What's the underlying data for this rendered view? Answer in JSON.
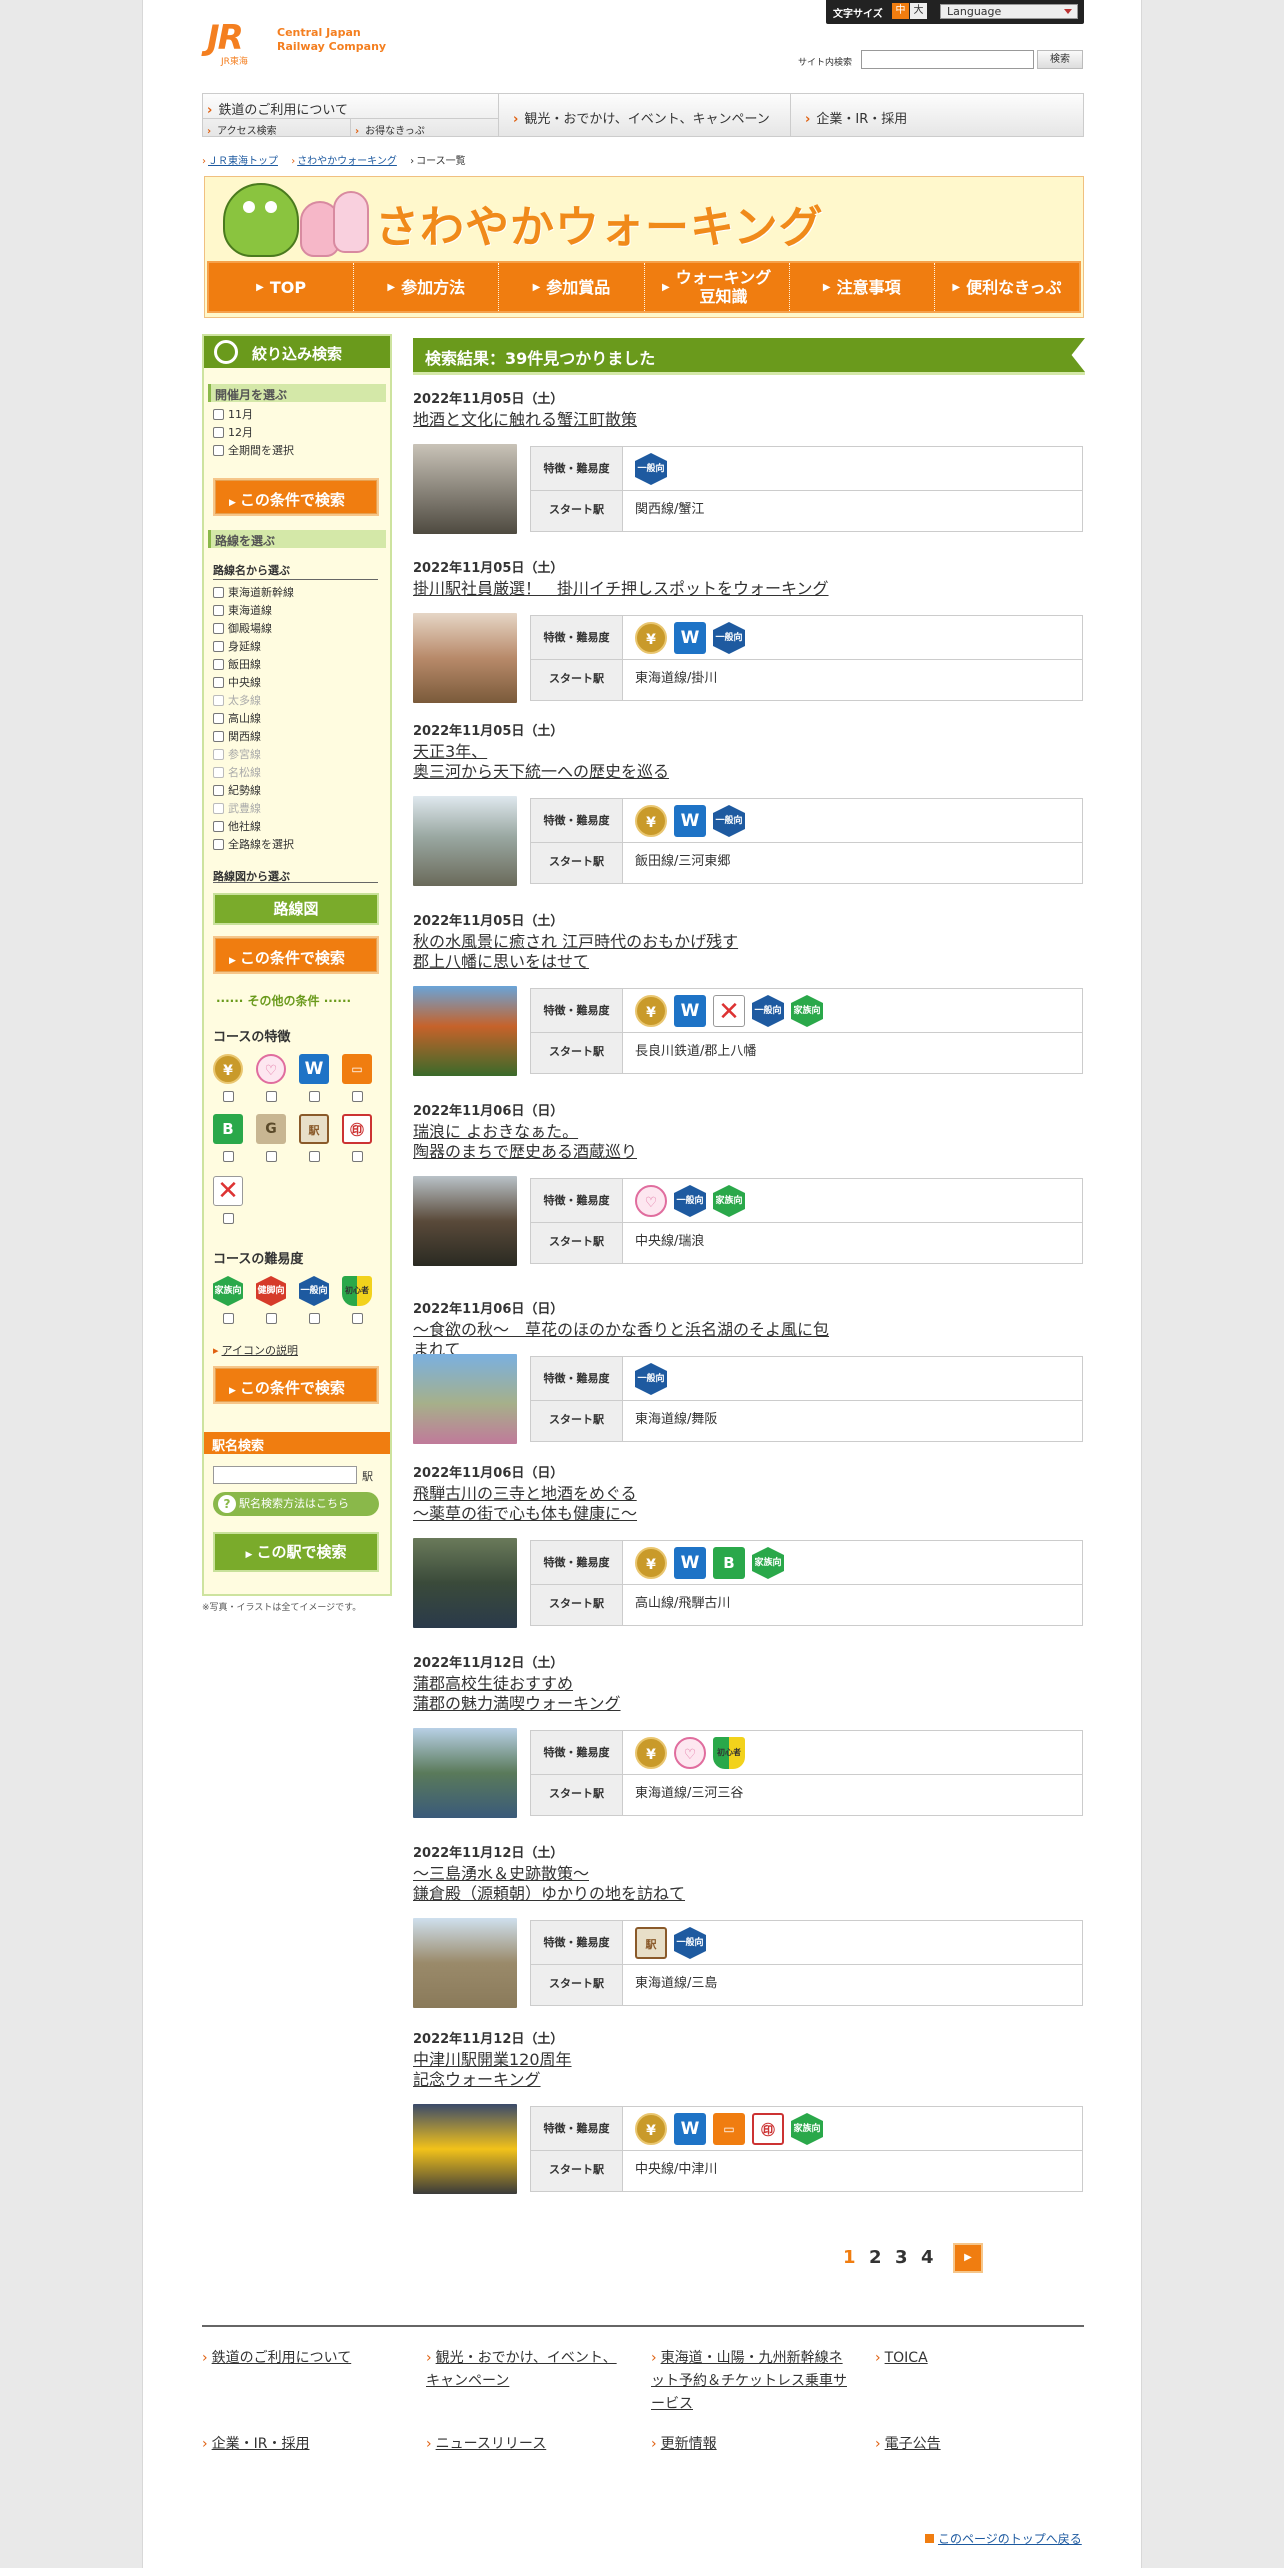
{
  "header": {
    "logo_mark": "JR",
    "logo_sub": "JR東海",
    "company_line1": "Central Japan",
    "company_line2": "Railway Company",
    "font_size_label": "文字サイズ",
    "size_medium": "中",
    "size_large": "大",
    "language": "Language",
    "site_search_label": "サイト内検索",
    "site_search_button": "検索"
  },
  "global_nav": {
    "item1": "鉄道のご利用について",
    "item1_sub1": "アクセス検索",
    "item1_sub2": "お得なきっぷ",
    "item2": "観光・おでかけ、イベント、キャンペーン",
    "item3": "企業・IR・採用"
  },
  "breadcrumb": [
    "ＪＲ東海トップ",
    "さわやかウォーキング",
    "コース一覧"
  ],
  "banner": {
    "title": "さわやかウォーキング",
    "nav": [
      "TOP",
      "参加方法",
      "参加賞品",
      "ウォーキング\n豆知識",
      "注意事項",
      "便利なきっぷ"
    ]
  },
  "sidebar": {
    "title": "絞り込み検索",
    "month_heading": "開催月を選ぶ",
    "months": [
      "11月",
      "12月",
      "全期間を選択"
    ],
    "search_button": "この条件で検索",
    "line_heading": "路線を選ぶ",
    "line_name_label": "路線名から選ぶ",
    "lines": [
      {
        "name": "東海道新幹線",
        "enabled": true
      },
      {
        "name": "東海道線",
        "enabled": true
      },
      {
        "name": "御殿場線",
        "enabled": true
      },
      {
        "name": "身延線",
        "enabled": true
      },
      {
        "name": "飯田線",
        "enabled": true
      },
      {
        "name": "中央線",
        "enabled": true
      },
      {
        "name": "太多線",
        "enabled": false
      },
      {
        "name": "高山線",
        "enabled": true
      },
      {
        "name": "関西線",
        "enabled": true
      },
      {
        "name": "参宮線",
        "enabled": false
      },
      {
        "name": "名松線",
        "enabled": false
      },
      {
        "name": "紀勢線",
        "enabled": true
      },
      {
        "name": "武豊線",
        "enabled": false
      },
      {
        "name": "他社線",
        "enabled": true
      },
      {
        "name": "全路線を選択",
        "enabled": true
      }
    ],
    "map_label": "路線図から選ぶ",
    "map_button": "路線図",
    "other_heading": "その他の条件",
    "feature_label": "コースの特徴",
    "difficulty_label": "コースの難易度",
    "icon_help": "アイコンの説明",
    "station_heading": "駅名検索",
    "station_suffix": "駅",
    "station_help": "駅名検索方法はこちら",
    "station_button": "この駅で検索",
    "note": "※写真・イラストは全てイメージです。"
  },
  "icon_text": {
    "yen": "¥",
    "heart": "♡",
    "w": "W",
    "train": "▭",
    "b": "B",
    "g": "G",
    "stamp": "駅",
    "circle": "㊞",
    "x": "✕",
    "ippan": "一般向",
    "kazoku": "家族向",
    "kenkyaku": "健脚向",
    "beginner": "初心者"
  },
  "results": {
    "heading": "検索結果：39件見つかりました",
    "feature_label": "特徴・難易度",
    "start_label": "スタート駅",
    "courses": [
      {
        "date": "2022年11月05日（土）",
        "title": "地酒と文化に触れる蟹江町散策",
        "station": "関西線/蟹江",
        "icons": [
          "ippan"
        ]
      },
      {
        "date": "2022年11月05日（土）",
        "title": "掛川駅社員厳選！　掛川イチ押しスポットをウォーキング",
        "station": "東海道線/掛川",
        "icons": [
          "yen",
          "w",
          "ippan"
        ]
      },
      {
        "date": "2022年11月05日（土）",
        "title": "天正3年、\n奥三河から天下統一への歴史を巡る",
        "station": "飯田線/三河東郷",
        "icons": [
          "yen",
          "w",
          "ippan"
        ]
      },
      {
        "date": "2022年11月05日（土）",
        "title": "秋の水風景に癒され 江戸時代のおもかげ残す\n郡上八幡に思いをはせて",
        "station": "長良川鉄道/郡上八幡",
        "icons": [
          "yen",
          "w",
          "x",
          "ippan",
          "kazoku"
        ]
      },
      {
        "date": "2022年11月06日（日）",
        "title": "瑞浪に よおきなぁた。\n陶器のまちで歴史ある酒蔵巡り",
        "station": "中央線/瑞浪",
        "icons": [
          "heart",
          "ippan",
          "kazoku"
        ]
      },
      {
        "date": "2022年11月06日（日）",
        "title": "～食欲の秋～　草花のほのかな香りと浜名湖のそよ風に包まれて",
        "station": "東海道線/舞阪",
        "icons": [
          "ippan"
        ]
      },
      {
        "date": "2022年11月06日（日）",
        "title": "飛騨古川の三寺と地酒をめぐる\n～薬草の街で心も体も健康に～",
        "station": "高山線/飛騨古川",
        "icons": [
          "yen",
          "w",
          "b",
          "kazoku"
        ]
      },
      {
        "date": "2022年11月12日（土）",
        "title": "蒲郡高校生徒おすすめ\n蒲郡の魅力満喫ウォーキング",
        "station": "東海道線/三河三谷",
        "icons": [
          "yen",
          "heart",
          "beginner"
        ]
      },
      {
        "date": "2022年11月12日（土）",
        "title": "～三島湧水＆史跡散策～\n鎌倉殿（源頼朝）ゆかりの地を訪ねて",
        "station": "東海道線/三島",
        "icons": [
          "stamp",
          "ippan"
        ]
      },
      {
        "date": "2022年11月12日（土）",
        "title": "中津川駅開業120周年\n記念ウォーキング",
        "station": "中央線/中津川",
        "icons": [
          "yen",
          "w",
          "train",
          "circle",
          "kazoku"
        ]
      }
    ]
  },
  "pager": {
    "pages": [
      "1",
      "2",
      "3",
      "4"
    ],
    "current": "1",
    "next": "▶"
  },
  "footer": {
    "links": [
      "鉄道のご利用について",
      "観光・おでかけ、イベント、キャンペーン",
      "東海道・山陽・九州新幹線ネット予約＆チケットレス乗車サービス",
      "TOICA",
      "企業・IR・採用",
      "ニュースリリース",
      "更新情報",
      "電子公告"
    ],
    "page_top": "このページのトップへ戻る"
  },
  "colors": {
    "brand_orange": "#f07d10",
    "brand_green": "#6a9a1c",
    "sidebar_bg": "#fffce0"
  }
}
